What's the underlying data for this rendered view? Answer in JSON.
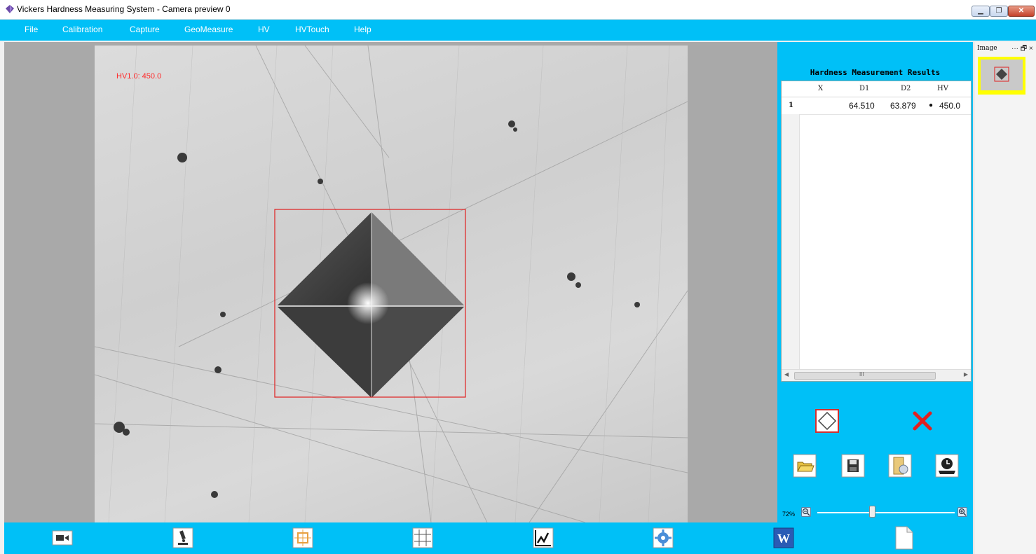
{
  "window": {
    "title": "Vickers Hardness Measuring System - Camera preview 0",
    "icon": "app-gem-icon",
    "controls": [
      "minimize-icon",
      "restore-icon",
      "close-icon"
    ]
  },
  "menu": {
    "items": [
      "File",
      "Calibration",
      "Capture",
      "GeoMeasure",
      "HV",
      "HVTouch",
      "Help"
    ]
  },
  "image_view": {
    "overlay_label": "HV1.0: 450.0",
    "overlay_color": "#ff2a2a"
  },
  "results": {
    "title": "Hardness Measurement Results",
    "columns": [
      "X",
      "D1",
      "D2",
      "HV"
    ],
    "rows": [
      {
        "index": "1",
        "x": "",
        "d1": "64.510",
        "d2": "63.879",
        "hv": "450.0"
      }
    ],
    "scroll_indicator": "III"
  },
  "action_icons": {
    "row1": [
      "measure-diamond-icon",
      "delete-x-icon"
    ],
    "row2": [
      "open-folder-icon",
      "save-disk-icon",
      "report-icon",
      "clock-export-icon"
    ]
  },
  "zoom": {
    "label": "72%",
    "level_percent": 72,
    "zoom_out": "zoom-out-icon",
    "zoom_in": "zoom-in-icon"
  },
  "side_panel": {
    "title": "Image",
    "controls": "··· 🗗 ×"
  },
  "toolbar": {
    "tools": [
      "camera-icon",
      "microscope-icon",
      "crosshair-frame-icon",
      "grid-icon",
      "chart-line-icon",
      "settings-gear-icon",
      "word-document-icon",
      "blank-document-icon"
    ]
  },
  "colors": {
    "accent": "#00c0f7",
    "measure_box": "#e02020",
    "thumb_highlight": "#ffff00"
  }
}
